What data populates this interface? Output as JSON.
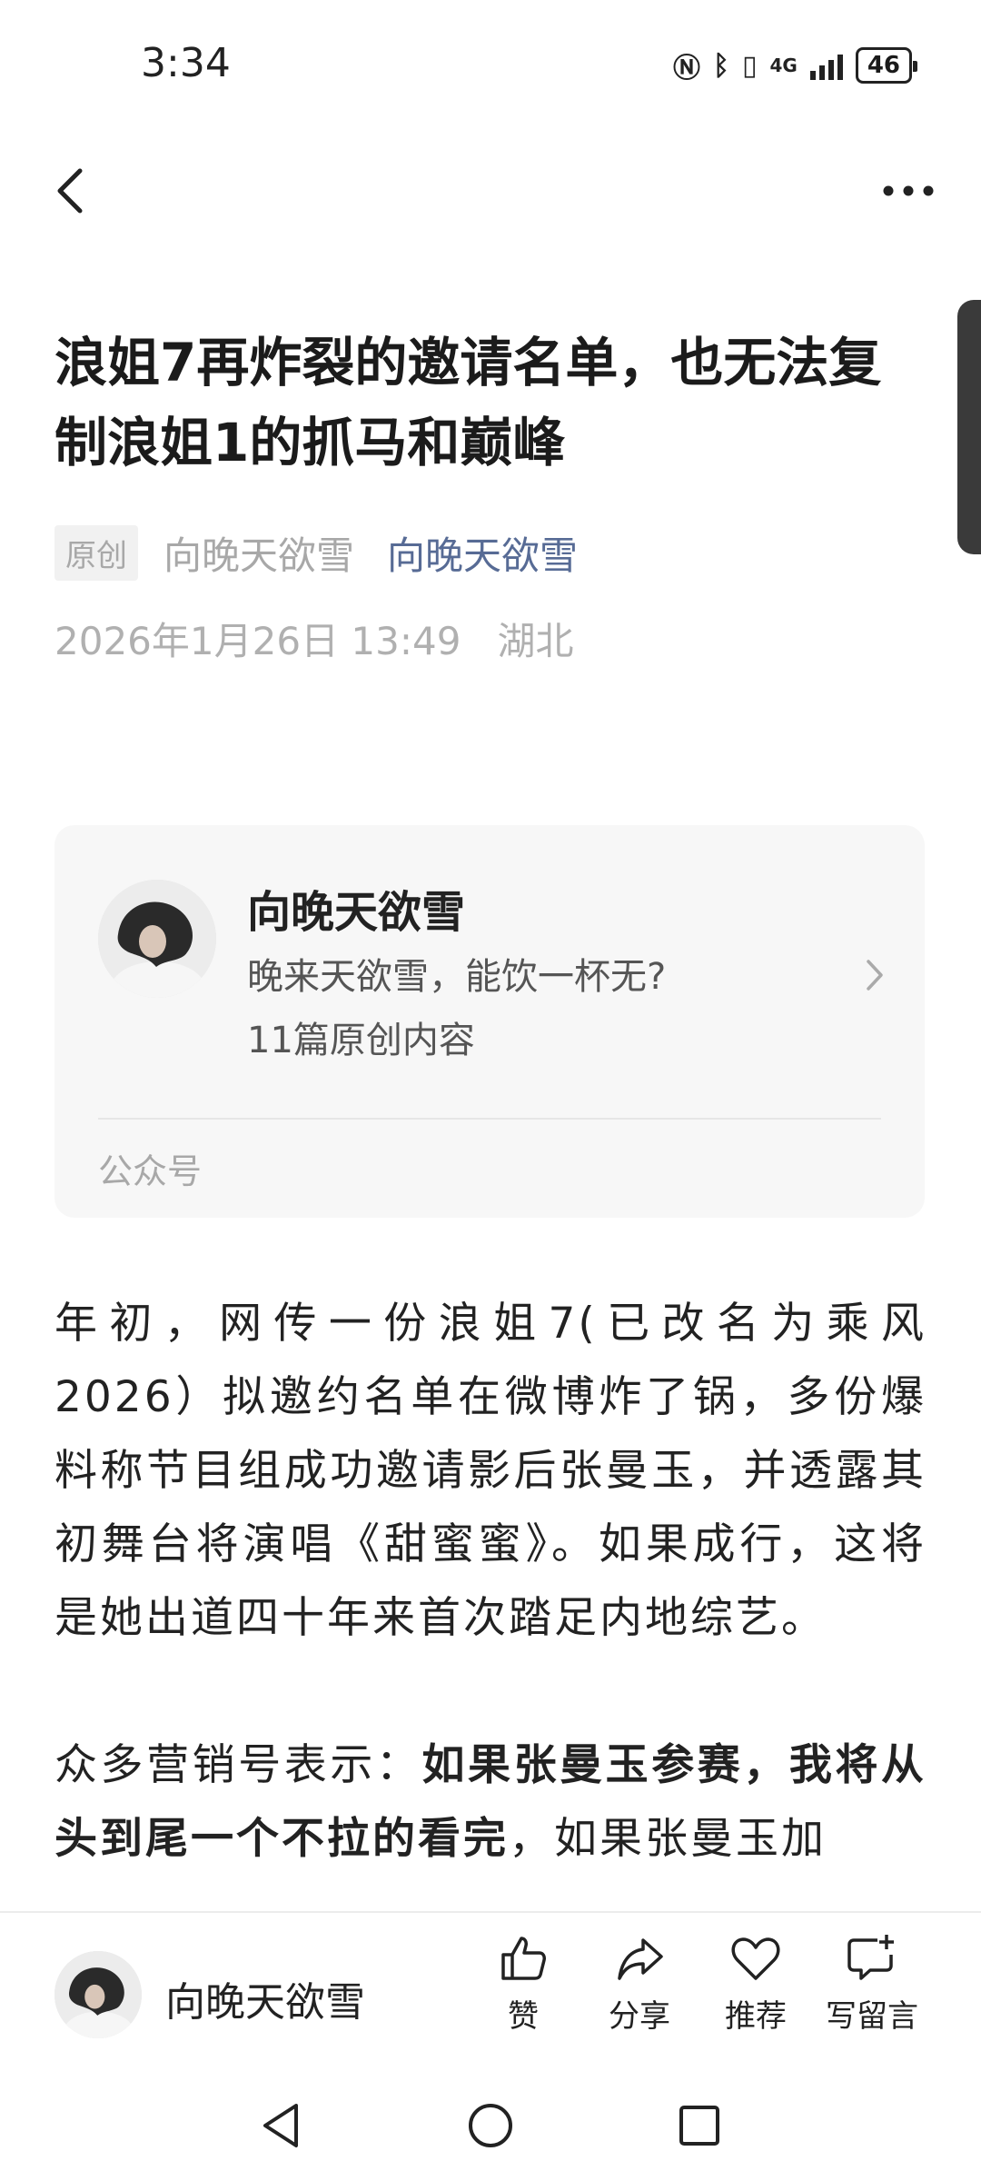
{
  "status": {
    "time": "3:34",
    "network": "4G",
    "battery": "46"
  },
  "article": {
    "title": "浪姐7再炸裂的邀请名单，也无法复制浪姐1的抓马和巅峰",
    "tag": "原创",
    "author": "向晚天欲雪",
    "account_link": "向晚天欲雪",
    "date": "2026年1月26日 13:49",
    "location": "湖北"
  },
  "card": {
    "name": "向晚天欲雪",
    "description": "晚来天欲雪，能饮一杯无?",
    "count": "11篇原创内容",
    "type": "公众号"
  },
  "body": {
    "p1": "年初，网传一份浪姐7(已改名为乘风2026）拟邀约名单在微博炸了锅，多份爆料称节目组成功邀请影后张曼玉，并透露其初舞台将演唱《甜蜜蜜》。如果成行，这将是她出道四十年来首次踏足内地综艺。",
    "p2_prefix": "众多营销号表示：",
    "p2_bold": "如果张曼玉参赛，我将从头到尾一个不拉的看完",
    "p2_suffix": "，如果张曼玉加"
  },
  "bottom_bar": {
    "author": "向晚天欲雪",
    "actions": [
      "赞",
      "分享",
      "推荐",
      "写留言"
    ]
  },
  "icons": [
    "back-icon",
    "more-icon",
    "chevron-right-icon",
    "thumbs-up-icon",
    "share-icon",
    "heart-icon",
    "comment-plus-icon",
    "nav-back-icon",
    "nav-home-icon",
    "nav-recents-icon"
  ]
}
